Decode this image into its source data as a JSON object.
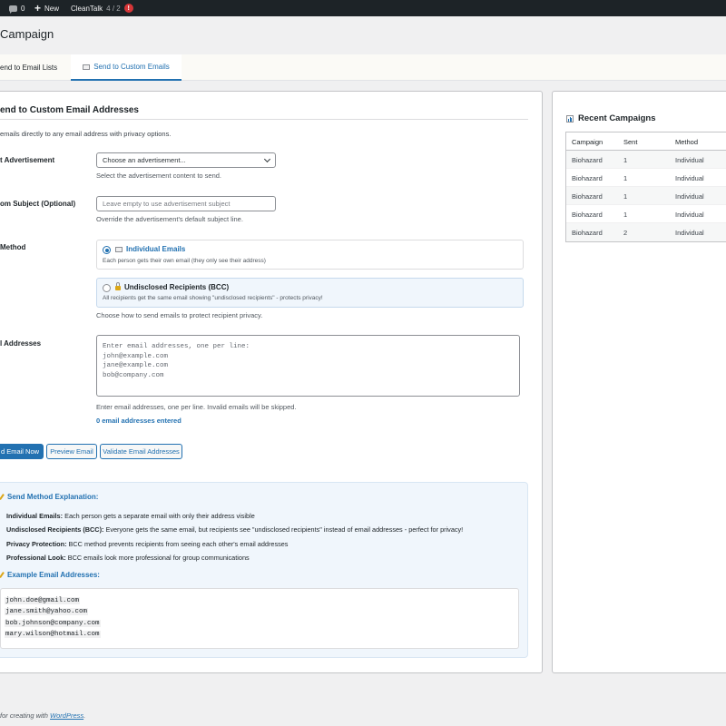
{
  "adminbar": {
    "comments_count": "0",
    "new_label": "New",
    "cleantalk_label": "CleanTalk",
    "cleantalk_stats": "4 / 2",
    "alert": "!"
  },
  "page": {
    "title": "Campaign"
  },
  "tabs": [
    {
      "label": "end to Email Lists",
      "active": false
    },
    {
      "label": "Send to Custom Emails",
      "active": true
    }
  ],
  "form": {
    "heading": "end to Custom Email Addresses",
    "intro": "emails directly to any email address with privacy options.",
    "advertisement": {
      "label": "t Advertisement",
      "selected": "Choose an advertisement...",
      "description": "Select the advertisement content to send."
    },
    "subject": {
      "label": "om Subject (Optional)",
      "placeholder": "Leave empty to use advertisement subject",
      "description": "Override the advertisement's default subject line."
    },
    "method": {
      "label": " Method",
      "options": [
        {
          "title": "Individual Emails",
          "sub": "Each person gets their own email (they only see their address)",
          "checked": true
        },
        {
          "title": "Undisclosed Recipients (BCC)",
          "sub": "All recipients get the same email showing \"undisclosed recipients\" - protects privacy!",
          "checked": false
        }
      ],
      "description": "Choose how to send emails to protect recipient privacy."
    },
    "addresses": {
      "label": "l Addresses",
      "placeholder": "Enter email addresses, one per line:\njohn@example.com\njane@example.com\nbob@company.com",
      "description": "Enter email addresses, one per line. Invalid emails will be skipped.",
      "count": "0 email addresses entered"
    },
    "buttons": {
      "send": "d Email Now",
      "preview": "Preview Email",
      "validate": "Validate Email Addresses"
    }
  },
  "explanation": {
    "heading": "Send Method Explanation:",
    "items": [
      {
        "term": "Individual Emails:",
        "text": " Each person gets a separate email with only their address visible"
      },
      {
        "term": "Undisclosed Recipients (BCC):",
        "text": " Everyone gets the same email, but recipients see \"undisclosed recipients\" instead of email addresses - perfect for privacy!"
      },
      {
        "term": "Privacy Protection:",
        "text": " BCC method prevents recipients from seeing each other's email addresses"
      },
      {
        "term": "Professional Look:",
        "text": " BCC emails look more professional for group communications"
      }
    ],
    "examples_heading": "Example Email Addresses:",
    "examples": [
      "john.doe@gmail.com",
      "jane.smith@yahoo.com",
      "bob.johnson@company.com",
      "mary.wilson@hotmail.com"
    ]
  },
  "recent": {
    "title": "Recent Campaigns",
    "columns": [
      "Campaign",
      "Sent",
      "Method"
    ],
    "rows": [
      [
        "Biohazard",
        "1",
        "Individual"
      ],
      [
        "Biohazard",
        "1",
        "Individual"
      ],
      [
        "Biohazard",
        "1",
        "Individual"
      ],
      [
        "Biohazard",
        "1",
        "Individual"
      ],
      [
        "Biohazard",
        "2",
        "Individual"
      ]
    ]
  },
  "footer": {
    "text": "for creating with ",
    "link": "WordPress",
    "end": "."
  },
  "colors": {
    "accent": "#2271b1",
    "adminbar": "#1d2327",
    "background": "#f0f0f1",
    "alert": "#d63638"
  }
}
